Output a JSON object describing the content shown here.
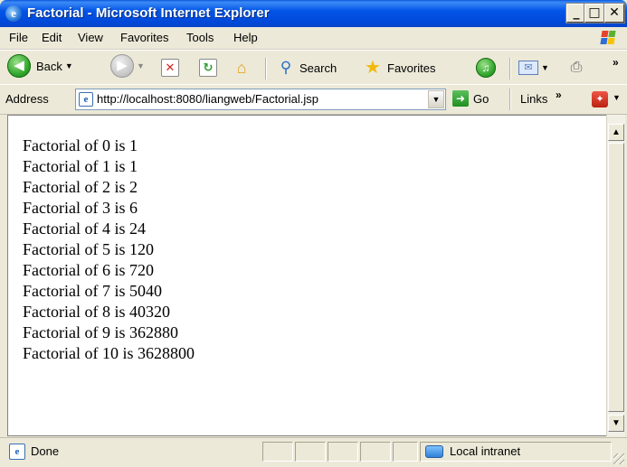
{
  "window": {
    "title": "Factorial - Microsoft Internet Explorer",
    "min_glyph": "_",
    "max_glyph": "□",
    "close_glyph": "✕"
  },
  "menu": {
    "items": [
      {
        "label": "File"
      },
      {
        "label": "Edit"
      },
      {
        "label": "View"
      },
      {
        "label": "Favorites"
      },
      {
        "label": "Tools"
      },
      {
        "label": "Help"
      }
    ]
  },
  "toolbar": {
    "back_label": "Back",
    "search_label": "Search",
    "favorites_label": "Favorites",
    "overflow": "»"
  },
  "address": {
    "label": "Address",
    "url": "http://localhost:8080/liangweb/Factorial.jsp",
    "go_label": "Go",
    "links_label": "Links",
    "overflow": "»"
  },
  "content": {
    "lines": [
      "Factorial of 0 is 1",
      "Factorial of 1 is 1",
      "Factorial of 2 is 2",
      "Factorial of 3 is 6",
      "Factorial of 4 is 24",
      "Factorial of 5 is 120",
      "Factorial of 6 is 720",
      "Factorial of 7 is 5040",
      "Factorial of 8 is 40320",
      "Factorial of 9 is 362880",
      "Factorial of 10 is 3628800"
    ]
  },
  "status": {
    "text": "Done",
    "zone": "Local intranet"
  },
  "icons": {
    "app": "ie-icon",
    "back": "back-arrow-icon",
    "forward": "forward-arrow-icon",
    "stop": "stop-icon",
    "refresh": "refresh-icon",
    "home": "home-icon",
    "search": "search-icon",
    "favorites": "star-icon",
    "media": "media-icon",
    "mail": "mail-icon",
    "print": "print-icon"
  },
  "colors": {
    "titlebar": "#0255E7",
    "chrome": "#ECE9D8",
    "content_bg": "#FFFFFF"
  }
}
